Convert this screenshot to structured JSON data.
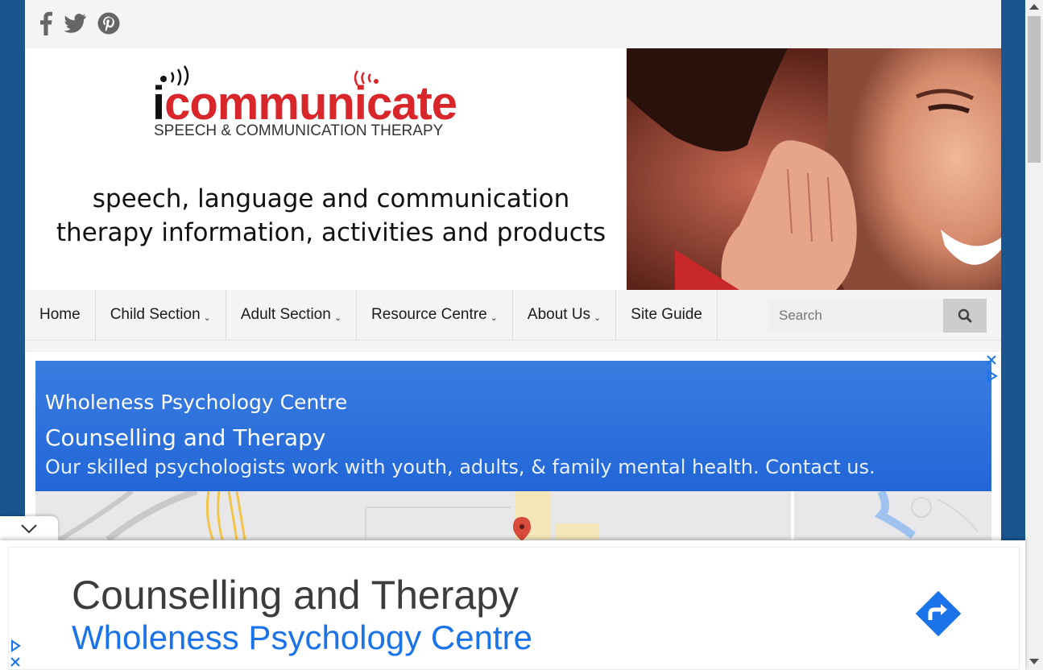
{
  "logo": {
    "brand_i": "i",
    "brand_rest": "communicate",
    "subtitle": "SPEECH & COMMUNICATION THERAPY"
  },
  "tagline": {
    "line1": "speech, language and communication",
    "line2": "therapy information, activities and products"
  },
  "social": {
    "icons": [
      "facebook-icon",
      "twitter-icon",
      "pinterest-icon"
    ]
  },
  "nav": {
    "items": [
      {
        "label": "Home",
        "dropdown": false
      },
      {
        "label": "Child Section",
        "dropdown": true
      },
      {
        "label": "Adult Section",
        "dropdown": true
      },
      {
        "label": "Resource Centre",
        "dropdown": true
      },
      {
        "label": "About Us",
        "dropdown": true
      },
      {
        "label": "Site Guide",
        "dropdown": false
      }
    ],
    "search_placeholder": "Search"
  },
  "ad": {
    "advertiser": "Wholeness Psychology Centre",
    "title": "Counselling and Therapy",
    "description": "Our skilled psychologists work with youth, adults, & family mental health. Contact us."
  },
  "anchor_ad": {
    "title": "Counselling and Therapy",
    "advertiser": "Wholeness Psychology Centre"
  },
  "colors": {
    "frame_blue": "#1a5590",
    "brand_red": "#d8262a",
    "ad_blue": "#2266d8",
    "link_blue": "#1a73e8"
  }
}
